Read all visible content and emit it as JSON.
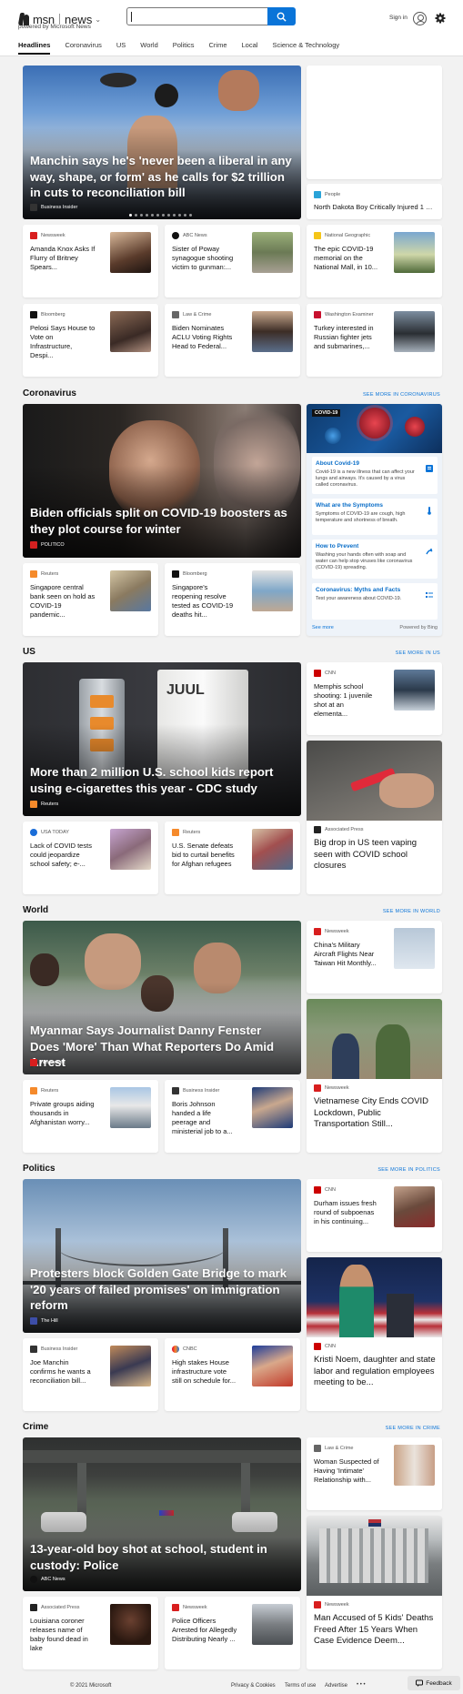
{
  "header": {
    "logo_msn": "msn",
    "logo_news": "news",
    "powered": "powered by Microsoft News",
    "search_placeholder": "",
    "signin": "Sign in",
    "icons": [
      "search-icon",
      "avatar-icon",
      "gear-icon",
      "chevron-down-icon"
    ],
    "accent": "#0a74d8"
  },
  "nav": [
    "Headlines",
    "Coronavirus",
    "US",
    "World",
    "Politics",
    "Crime",
    "Local",
    "Science & Technology"
  ],
  "headlines": {
    "hero": {
      "title": "Manchin says he's 'never been a liberal in any way, shape, or form' as he calls for $2 trillion in cuts to reconciliation bill",
      "source": "Business Insider"
    },
    "side_top": {
      "source": "People",
      "title": "North Dakota Boy Critically Injured 1 Da..."
    },
    "cards": [
      {
        "source": "Newsweek",
        "title": "Amanda Knox Asks If Flurry of Britney Spears..."
      },
      {
        "source": "ABC News",
        "title": "Sister of Poway synagogue shooting victim to gunman:..."
      },
      {
        "source": "National Geographic",
        "title": "The epic COVID-19 memorial on the National Mall, in 10..."
      },
      {
        "source": "Bloomberg",
        "title": "Pelosi Says House to Vote on Infrastructure, Despi..."
      },
      {
        "source": "Law & Crime",
        "title": "Biden Nominates ACLU Voting Rights Head to Federal..."
      },
      {
        "source": "Washington Examiner",
        "title": "Turkey interested in Russian fighter jets and submarines,..."
      }
    ]
  },
  "coronavirus": {
    "title": "Coronavirus",
    "more": "SEE MORE IN CORONAVIRUS",
    "hero": {
      "title": "Biden officials split on COVID-19 boosters as they plot course for winter",
      "source": "POLITICO"
    },
    "cards": [
      {
        "source": "Reuters",
        "title": "Singapore central bank seen on hold as COVID-19 pandemic..."
      },
      {
        "source": "Bloomberg",
        "title": "Singapore's reopening resolve tested as COVID-19 deaths hit..."
      }
    ],
    "panel": {
      "badge": "COVID-19",
      "rows": [
        {
          "h": "About Covid-19",
          "b": "Covid-19 is a new illness that can affect your lungs and airways. It's caused by a virus called coronavirus."
        },
        {
          "h": "What are the Symptoms",
          "b": "Symptoms of COVID-19 are cough, high temperature and shortness of breath."
        },
        {
          "h": "How to Prevent",
          "b": "Washing your hands often with soap and water can help stop viruses like coronavirus (COVID-19) spreading."
        },
        {
          "h": "Coronavirus: Myths and Facts",
          "b": "Test your awareness about COVID-19."
        }
      ],
      "see_more": "See more",
      "powered": "Powered by Bing"
    }
  },
  "us": {
    "title": "US",
    "more": "SEE MORE IN US",
    "hero": {
      "title": "More than 2 million U.S. school kids report using e-cigarettes this year - CDC study",
      "source": "Reuters"
    },
    "side_top": {
      "source": "CNN",
      "title": "Memphis school shooting: 1 juvenile shot at an elementa..."
    },
    "cards": [
      {
        "source": "USA TODAY",
        "title": "Lack of COVID tests could jeopardize school safety; e-..."
      },
      {
        "source": "Reuters",
        "title": "U.S. Senate defeats bid to curtail benefits for Afghan refugees"
      }
    ],
    "tall": {
      "source": "Associated Press",
      "title": "Big drop in US teen vaping seen with COVID school closures"
    }
  },
  "world": {
    "title": "World",
    "more": "SEE MORE IN WORLD",
    "hero": {
      "title": "Myanmar Says Journalist Danny Fenster Does 'More' Than What Reporters Do Amid Arrest",
      "source": "Newsweek"
    },
    "side_top": {
      "source": "Newsweek",
      "title": "China's Military Aircraft Flights Near Taiwan Hit Monthly..."
    },
    "cards": [
      {
        "source": "Reuters",
        "title": "Private groups aiding thousands in Afghanistan worry..."
      },
      {
        "source": "Business Insider",
        "title": "Boris Johnson handed a life peerage and ministerial job to a..."
      }
    ],
    "tall": {
      "source": "Newsweek",
      "title": "Vietnamese City Ends COVID Lockdown, Public Transportation Still..."
    }
  },
  "politics": {
    "title": "Politics",
    "more": "SEE MORE IN POLITICS",
    "hero": {
      "title": "Protesters block Golden Gate Bridge to mark '20 years of failed promises' on immigration reform",
      "source": "The Hill"
    },
    "side_top": {
      "source": "CNN",
      "title": "Durham issues fresh round of subpoenas in his continuing..."
    },
    "cards": [
      {
        "source": "Business Insider",
        "title": "Joe Manchin confirms he wants a reconciliation bill..."
      },
      {
        "source": "CNBC",
        "title": "High stakes House infrastructure vote still on schedule for..."
      }
    ],
    "tall": {
      "source": "CNN",
      "title": "Kristi Noem, daughter and state labor and regulation employees meeting to be..."
    }
  },
  "crime": {
    "title": "Crime",
    "more": "SEE MORE IN CRIME",
    "hero": {
      "title": "13-year-old boy shot at school, student in custody: Police",
      "source": "ABC News"
    },
    "side_top": {
      "source": "Law & Crime",
      "title": "Woman Suspected of Having 'Intimate' Relationship with..."
    },
    "cards": [
      {
        "source": "Associated Press",
        "title": "Louisiana coroner releases name of baby found dead in lake"
      },
      {
        "source": "Newsweek",
        "title": "Police Officers Arrested for Allegedly Distributing Nearly ..."
      }
    ],
    "tall": {
      "source": "Newsweek",
      "title": "Man Accused of 5 Kids' Deaths Freed After 15 Years When Case Evidence Deem..."
    }
  },
  "footer": {
    "copyright": "© 2021 Microsoft",
    "privacy": "Privacy & Cookies",
    "terms": "Terms of use",
    "advertise": "Advertise",
    "more": "• • •",
    "feedback": "Feedback"
  }
}
